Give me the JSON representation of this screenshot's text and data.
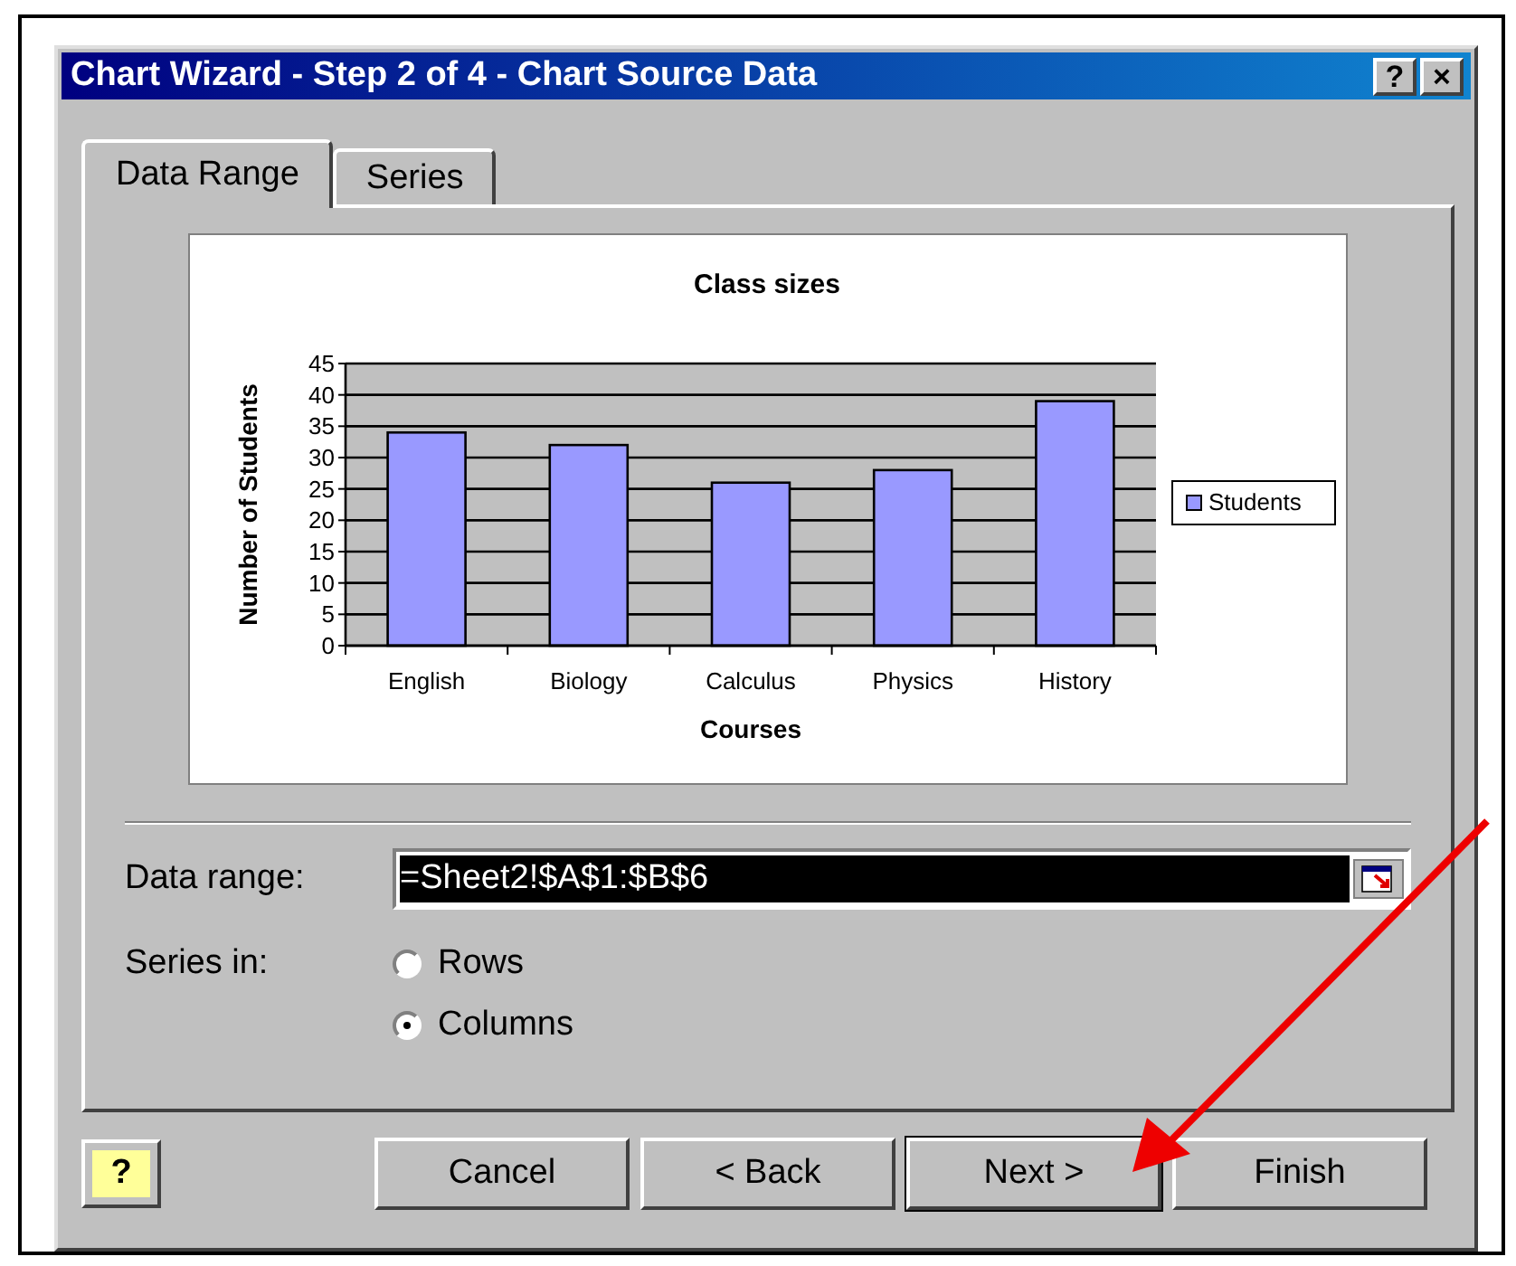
{
  "window": {
    "title": "Chart Wizard - Step 2 of 4 - Chart Source Data",
    "title_buttons": [
      "?",
      "×"
    ]
  },
  "tabs": [
    {
      "label": "Data Range",
      "selected": true
    },
    {
      "label": "Series",
      "selected": false
    }
  ],
  "preview": {
    "chart_data": {
      "type": "bar",
      "title": "Class sizes",
      "xlabel": "Courses",
      "ylabel": "Number of Students",
      "categories": [
        "English",
        "Biology",
        "Calculus",
        "Physics",
        "History"
      ],
      "series": [
        {
          "name": "Students",
          "color": "#9999ff",
          "values": [
            34,
            32,
            26,
            28,
            39
          ]
        }
      ],
      "ylim": [
        0,
        45
      ],
      "yticks": [
        0,
        5,
        10,
        15,
        20,
        25,
        30,
        35,
        40,
        45
      ],
      "grid": true
    }
  },
  "data_range": {
    "label": "Data range:",
    "value": "=Sheet2!$A$1:$B$6"
  },
  "series_in": {
    "label": "Series in:",
    "options": [
      {
        "label": "Rows",
        "selected": false
      },
      {
        "label": "Columns",
        "selected": true
      }
    ]
  },
  "help_button": {
    "label": "?"
  },
  "buttons": [
    {
      "label": "Cancel",
      "default": false
    },
    {
      "label": "< Back",
      "default": false
    },
    {
      "label": "Next >",
      "default": true
    },
    {
      "label": "Finish",
      "default": false
    }
  ]
}
